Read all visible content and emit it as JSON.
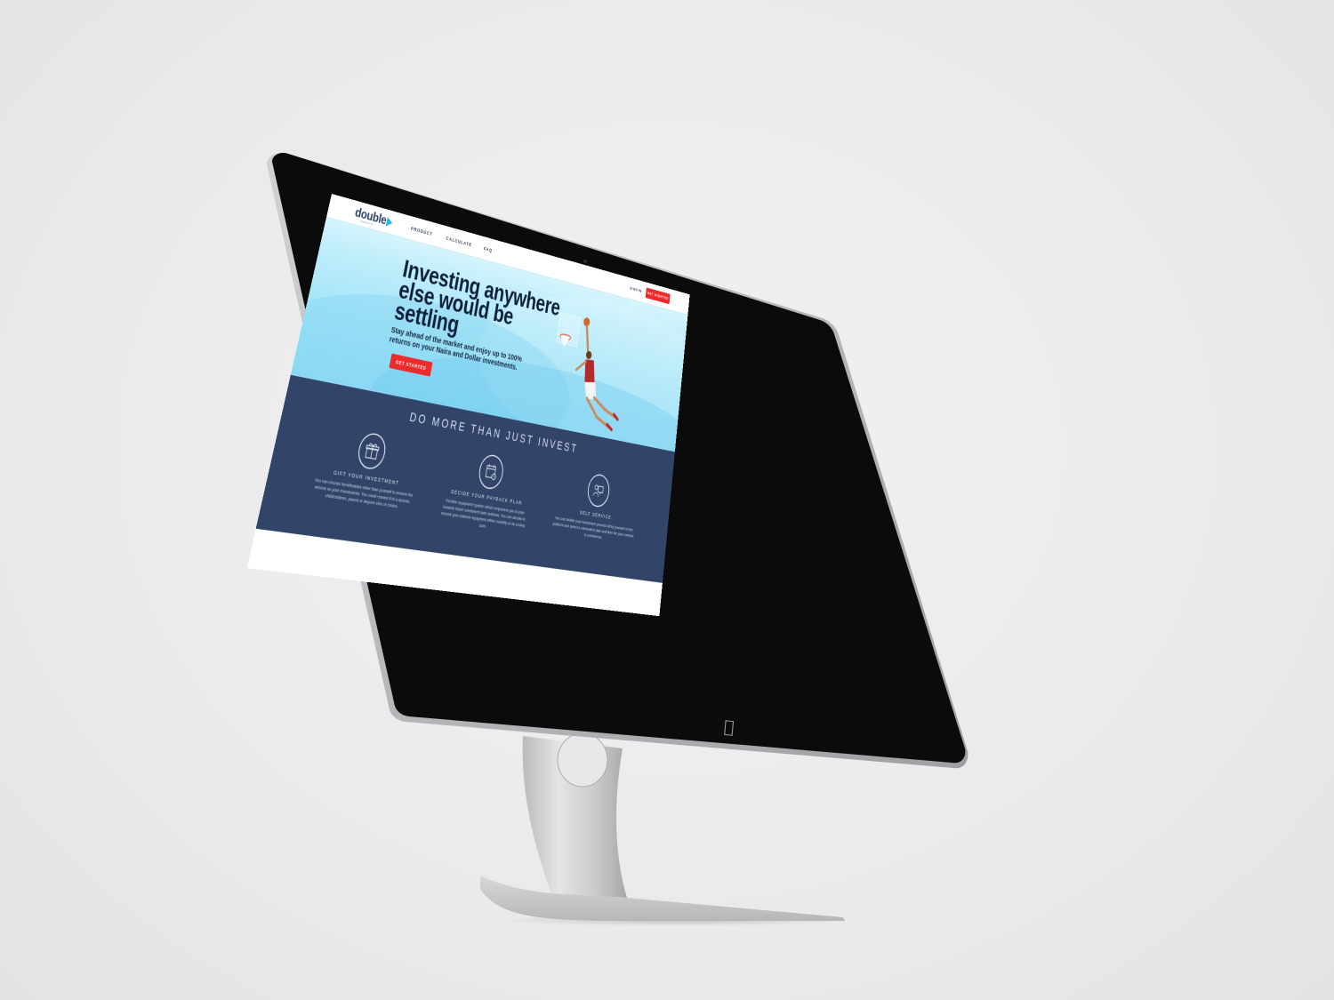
{
  "site": {
    "logo_text": "double",
    "logo_tagline": "powered by ..."
  },
  "nav": {
    "items": [
      "PRODUCT",
      "CALCULATE",
      "FAQ"
    ],
    "sign_in": "SIGN IN",
    "cta": "GET STARTED"
  },
  "hero": {
    "headline": "Investing anywhere else would be settling",
    "subline": "Stay ahead of the market and enjoy up to 100% returns on your Naira and Dollar investments.",
    "cta": "GET STARTED"
  },
  "features": {
    "title": "DO MORE THAN JUST INVEST",
    "items": [
      {
        "icon": "gift-icon",
        "title": "GIFT YOUR INVESTMENT",
        "description": "You can choose beneficiaries other than yourself to receive the returns on your investments. You could reward it to a spouse, child/children, parent or anyone else of choice."
      },
      {
        "icon": "calendar-icon",
        "title": "DECIDE YOUR PAYBACK PLAN",
        "description": "Flexible repayment system which empowers you to plan towards future consistent cash outflows. You can decide to receive your interest repayment either monthly or as a lump sum."
      },
      {
        "icon": "self-service-icon",
        "title": "SELF SERVICE",
        "description": "You can initiate your investment process all by yourself on the platform and select a convenient date and time for your contract to commence."
      }
    ]
  },
  "colors": {
    "accent_red": "#ee2b2b",
    "navy": "#324569",
    "sky": "#a2e4f8",
    "brand_blue": "#27b6e6"
  }
}
